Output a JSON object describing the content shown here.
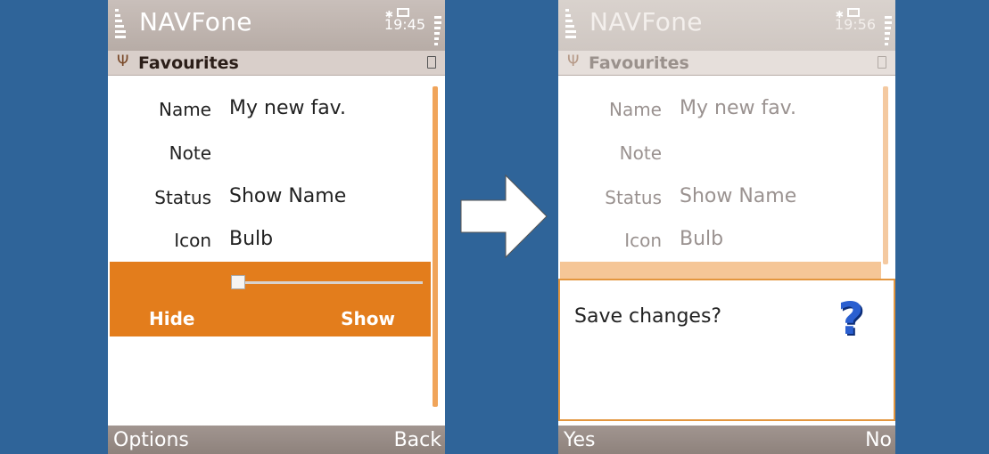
{
  "left_screen": {
    "app_title": "NAVFone",
    "clock": "19:45",
    "section_title": "Favourites",
    "fields": [
      {
        "label": "Name",
        "value": "My new fav."
      },
      {
        "label": "Note",
        "value": ""
      },
      {
        "label": "Status",
        "value": "Show Name"
      },
      {
        "label": "Icon",
        "value": "Bulb"
      }
    ],
    "slider": {
      "min_label": "Hide",
      "max_label": "Show",
      "value_fraction": 0.0
    },
    "softkeys": {
      "left": "Options",
      "right": "Back"
    }
  },
  "right_screen": {
    "app_title": "NAVFone",
    "clock": "19:56",
    "section_title": "Favourites",
    "fields": [
      {
        "label": "Name",
        "value": "My new fav."
      },
      {
        "label": "Note",
        "value": ""
      },
      {
        "label": "Status",
        "value": "Show Name"
      },
      {
        "label": "Icon",
        "value": "Bulb"
      }
    ],
    "dialog": {
      "message": "Save changes?",
      "icon": "question-icon"
    },
    "softkeys": {
      "left": "Yes",
      "right": "No"
    }
  },
  "transition_icon": "right-arrow-icon",
  "colors": {
    "background": "#2f6499",
    "accent": "#e37d1c",
    "dialog_border": "#e3963f",
    "softkey_bar": "#998d88"
  }
}
